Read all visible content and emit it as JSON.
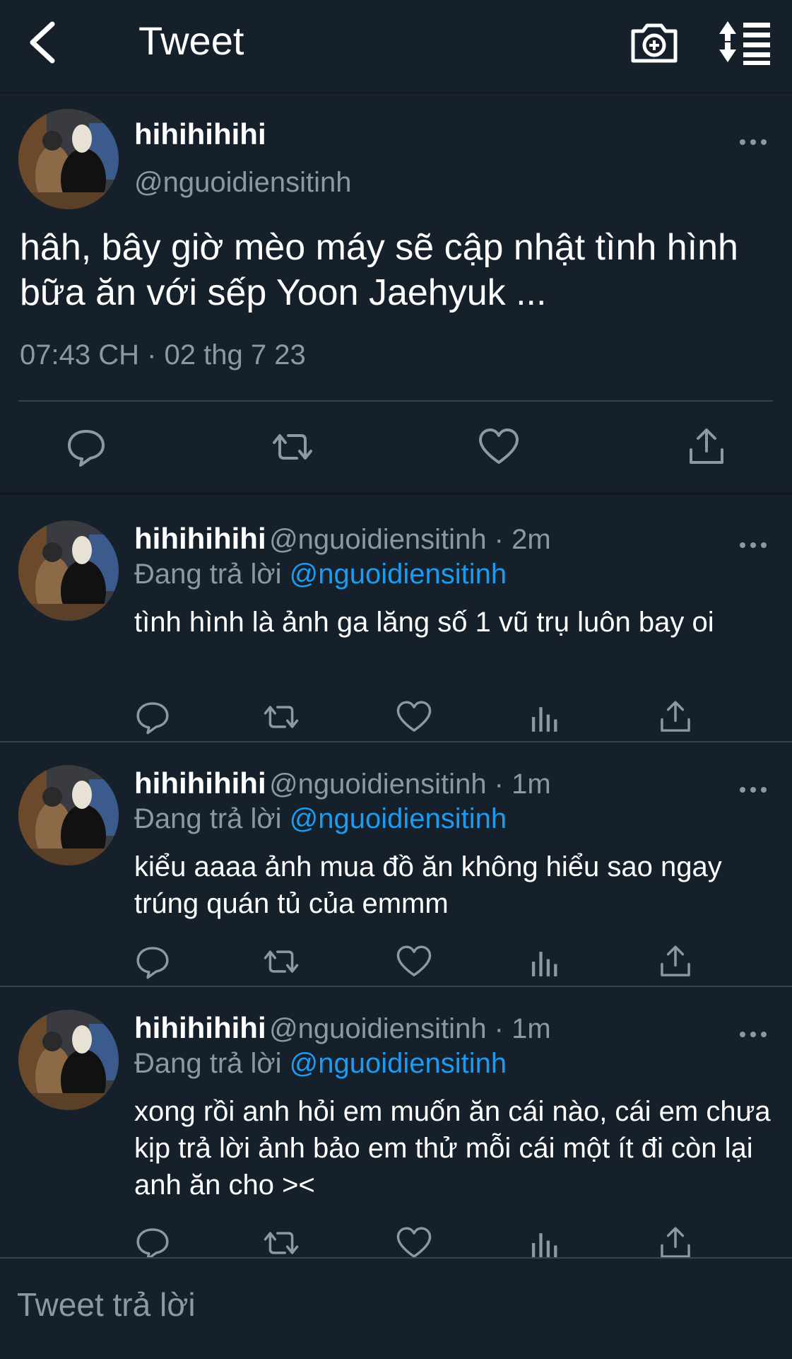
{
  "header": {
    "title": "Tweet"
  },
  "main_tweet": {
    "display_name": "hihihihihi",
    "handle": "@nguoidiensitinh",
    "text": "hâh, bây giờ mèo máy sẽ cập nhật tình hình bữa ăn với sếp Yoon Jaehyuk ...",
    "timestamp": "07:43 CH · 02 thg 7 23"
  },
  "replies": [
    {
      "display_name": "hihihihihi",
      "meta": "@nguoidiensitinh · 2m",
      "reply_prefix": "Đang trả lời",
      "reply_mention": "@nguoidiensitinh",
      "text": "tình hình là ảnh ga lăng số 1 vũ trụ luôn bay oi"
    },
    {
      "display_name": "hihihihihi",
      "meta": "@nguoidiensitinh · 1m",
      "reply_prefix": "Đang trả lời",
      "reply_mention": "@nguoidiensitinh",
      "text": "kiểu aaaa ảnh mua đồ ăn không hiểu sao ngay trúng quán tủ của emmm"
    },
    {
      "display_name": "hihihihihi",
      "meta": "@nguoidiensitinh · 1m",
      "reply_prefix": "Đang trả lời",
      "reply_mention": "@nguoidiensitinh",
      "text": "xong rồi anh hỏi em muốn ăn cái nào, cái em chưa kịp trả lời ảnh bảo em thử mỗi cái một ít đi còn lại anh ăn cho ><"
    }
  ],
  "compose": {
    "placeholder": "Tweet trả lời"
  },
  "icons": {
    "back": "back-arrow-icon",
    "camera": "camera-add-icon",
    "sort": "sort-icon",
    "more": "more-dots-icon",
    "reply": "reply-icon",
    "retweet": "retweet-icon",
    "like": "heart-icon",
    "views": "views-icon",
    "share": "share-icon"
  },
  "colors": {
    "background": "#15202b",
    "text": "#ffffff",
    "secondary": "#8b98a5",
    "accent": "#1d9bf0",
    "divider": "#38444d"
  }
}
